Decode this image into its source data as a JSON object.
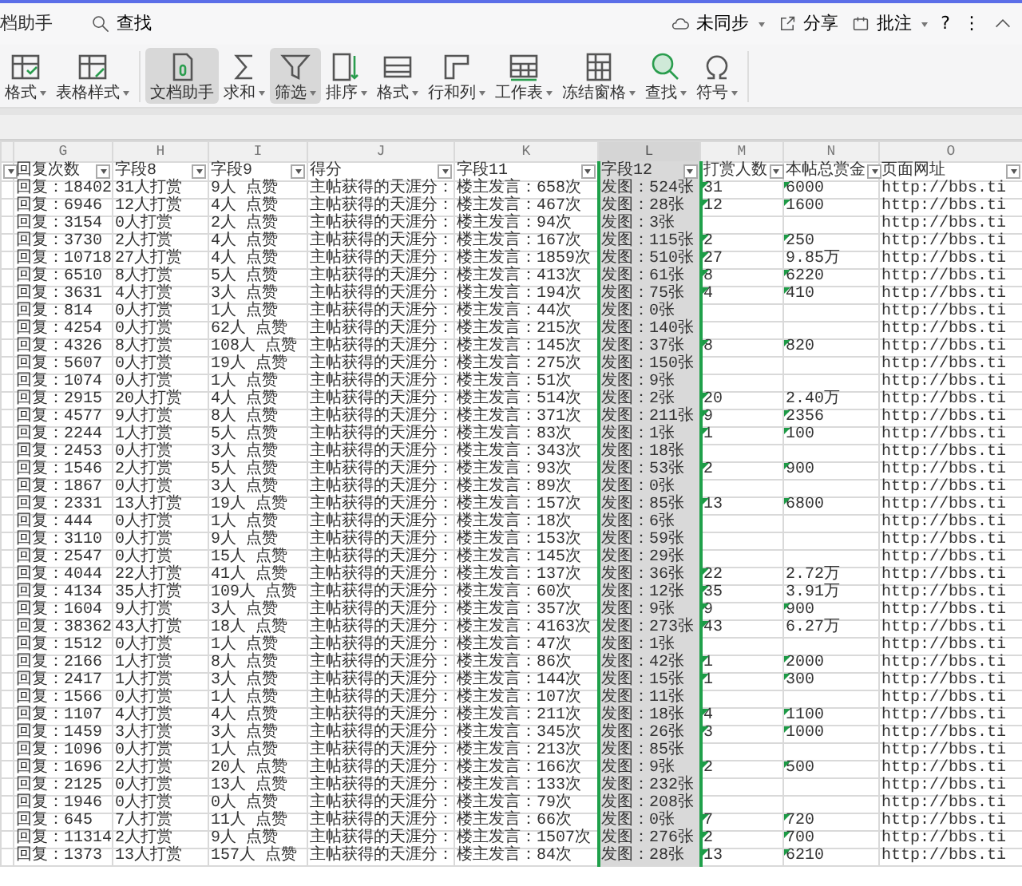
{
  "top_bar": {
    "tab": "档助手",
    "search": "查找",
    "sync": "未同步",
    "share": "分享",
    "comment": "批注",
    "help": "?",
    "more": "⋮"
  },
  "ribbon": [
    {
      "label": "格式",
      "kind": "table-format",
      "dropdown": true,
      "selected": false
    },
    {
      "label": "表格样式",
      "kind": "table-style",
      "dropdown": true,
      "selected": false
    },
    {
      "label": "文档助手",
      "kind": "assistant",
      "dropdown": false,
      "selected": true
    },
    {
      "label": "求和",
      "kind": "sum",
      "dropdown": true,
      "selected": false
    },
    {
      "label": "筛选",
      "kind": "filter",
      "dropdown": true,
      "selected": true
    },
    {
      "label": "排序",
      "kind": "sort",
      "dropdown": true,
      "selected": false
    },
    {
      "label": "格式",
      "kind": "cell-format",
      "dropdown": true,
      "selected": false
    },
    {
      "label": "行和列",
      "kind": "rows-cols",
      "dropdown": true,
      "selected": false
    },
    {
      "label": "工作表",
      "kind": "sheet",
      "dropdown": true,
      "selected": false
    },
    {
      "label": "冻结窗格",
      "kind": "freeze",
      "dropdown": true,
      "selected": false
    },
    {
      "label": "查找",
      "kind": "find",
      "dropdown": true,
      "selected": false
    },
    {
      "label": "符号",
      "kind": "symbol",
      "dropdown": true,
      "selected": false
    }
  ],
  "columns": [
    {
      "letter": "G",
      "heading": "回复次数",
      "selected": false
    },
    {
      "letter": "H",
      "heading": "字段8",
      "selected": false
    },
    {
      "letter": "I",
      "heading": "字段9",
      "selected": false
    },
    {
      "letter": "J",
      "heading": "得分",
      "selected": false
    },
    {
      "letter": "K",
      "heading": "字段11",
      "selected": false
    },
    {
      "letter": "L",
      "heading": "字段12",
      "selected": true
    },
    {
      "letter": "M",
      "heading": "打赏人数",
      "selected": false
    },
    {
      "letter": "N",
      "heading": "本帖总赏金",
      "selected": false
    },
    {
      "letter": "O",
      "heading": "页面网址",
      "selected": false
    }
  ],
  "rows": [
    {
      "cells": [
        "回复：18402",
        "31人打赏",
        "9人 点赞",
        "主帖获得的天涯分：",
        "楼主发言：658次",
        "发图：524张",
        "31",
        "6000",
        "http://bbs.ti"
      ],
      "m_flag": true,
      "n_flag": true
    },
    {
      "cells": [
        "回复：6946",
        "12人打赏",
        "4人 点赞",
        "主帖获得的天涯分：",
        "楼主发言：467次",
        "发图：28张",
        "12",
        "1600",
        "http://bbs.ti"
      ],
      "m_flag": true,
      "n_flag": true
    },
    {
      "cells": [
        "回复：3154",
        "0人打赏",
        "2人 点赞",
        "主帖获得的天涯分：",
        "楼主发言：94次",
        "发图：3张",
        null,
        null,
        "http://bbs.ti"
      ],
      "m_flag": false,
      "n_flag": false
    },
    {
      "cells": [
        "回复：3730",
        "2人打赏",
        "4人 点赞",
        "主帖获得的天涯分：",
        "楼主发言：167次",
        "发图：115张",
        "2",
        "250",
        "http://bbs.ti"
      ],
      "m_flag": true,
      "n_flag": true
    },
    {
      "cells": [
        "回复：10718",
        "27人打赏",
        "4人 点赞",
        "主帖获得的天涯分：",
        "楼主发言：1859次",
        "发图：510张",
        "27",
        "9.85万",
        "http://bbs.ti"
      ],
      "m_flag": true,
      "n_flag": false
    },
    {
      "cells": [
        "回复：6510",
        "8人打赏",
        "5人 点赞",
        "主帖获得的天涯分：",
        "楼主发言：413次",
        "发图：61张",
        "8",
        "6220",
        "http://bbs.ti"
      ],
      "m_flag": true,
      "n_flag": true
    },
    {
      "cells": [
        "回复：3631",
        "4人打赏",
        "3人 点赞",
        "主帖获得的天涯分：",
        "楼主发言：194次",
        "发图：75张",
        "4",
        "410",
        "http://bbs.ti"
      ],
      "m_flag": true,
      "n_flag": true
    },
    {
      "cells": [
        "回复：814",
        "0人打赏",
        "1人 点赞",
        "主帖获得的天涯分：",
        "楼主发言：44次",
        "发图：0张",
        null,
        null,
        "http://bbs.ti"
      ],
      "m_flag": false,
      "n_flag": false
    },
    {
      "cells": [
        "回复：4254",
        "0人打赏",
        "62人 点赞",
        "主帖获得的天涯分：",
        "楼主发言：215次",
        "发图：140张",
        null,
        null,
        "http://bbs.ti"
      ],
      "m_flag": false,
      "n_flag": false
    },
    {
      "cells": [
        "回复：4326",
        "8人打赏",
        "108人 点赞",
        "主帖获得的天涯分：",
        "楼主发言：145次",
        "发图：37张",
        "8",
        "820",
        "http://bbs.ti"
      ],
      "m_flag": true,
      "n_flag": true
    },
    {
      "cells": [
        "回复：5607",
        "0人打赏",
        "19人 点赞",
        "主帖获得的天涯分：",
        "楼主发言：275次",
        "发图：150张",
        null,
        null,
        "http://bbs.ti"
      ],
      "m_flag": false,
      "n_flag": false
    },
    {
      "cells": [
        "回复：1074",
        "0人打赏",
        "1人 点赞",
        "主帖获得的天涯分：",
        "楼主发言：51次",
        "发图：9张",
        null,
        null,
        "http://bbs.ti"
      ],
      "m_flag": false,
      "n_flag": false
    },
    {
      "cells": [
        "回复：2915",
        "20人打赏",
        "4人 点赞",
        "主帖获得的天涯分：",
        "楼主发言：514次",
        "发图：2张",
        "20",
        "2.40万",
        "http://bbs.ti"
      ],
      "m_flag": true,
      "n_flag": false
    },
    {
      "cells": [
        "回复：4577",
        "9人打赏",
        "8人 点赞",
        "主帖获得的天涯分：",
        "楼主发言：371次",
        "发图：211张",
        "9",
        "2356",
        "http://bbs.ti"
      ],
      "m_flag": true,
      "n_flag": true
    },
    {
      "cells": [
        "回复：2244",
        "1人打赏",
        "5人 点赞",
        "主帖获得的天涯分：",
        "楼主发言：83次",
        "发图：1张",
        "1",
        "100",
        "http://bbs.ti"
      ],
      "m_flag": true,
      "n_flag": true
    },
    {
      "cells": [
        "回复：2453",
        "0人打赏",
        "3人 点赞",
        "主帖获得的天涯分：",
        "楼主发言：343次",
        "发图：18张",
        null,
        null,
        "http://bbs.ti"
      ],
      "m_flag": false,
      "n_flag": false
    },
    {
      "cells": [
        "回复：1546",
        "2人打赏",
        "5人 点赞",
        "主帖获得的天涯分：",
        "楼主发言：93次",
        "发图：53张",
        "2",
        "900",
        "http://bbs.ti"
      ],
      "m_flag": true,
      "n_flag": true
    },
    {
      "cells": [
        "回复：1867",
        "0人打赏",
        "3人 点赞",
        "主帖获得的天涯分：",
        "楼主发言：89次",
        "发图：0张",
        null,
        null,
        "http://bbs.ti"
      ],
      "m_flag": false,
      "n_flag": false
    },
    {
      "cells": [
        "回复：2331",
        "13人打赏",
        "19人 点赞",
        "主帖获得的天涯分：",
        "楼主发言：157次",
        "发图：85张",
        "13",
        "6800",
        "http://bbs.ti"
      ],
      "m_flag": true,
      "n_flag": true
    },
    {
      "cells": [
        "回复：444",
        "0人打赏",
        "1人 点赞",
        "主帖获得的天涯分：",
        "楼主发言：18次",
        "发图：6张",
        null,
        null,
        "http://bbs.ti"
      ],
      "m_flag": false,
      "n_flag": false
    },
    {
      "cells": [
        "回复：3110",
        "0人打赏",
        "9人 点赞",
        "主帖获得的天涯分：",
        "楼主发言：153次",
        "发图：59张",
        null,
        null,
        "http://bbs.ti"
      ],
      "m_flag": false,
      "n_flag": false
    },
    {
      "cells": [
        "回复：2547",
        "0人打赏",
        "15人 点赞",
        "主帖获得的天涯分：",
        "楼主发言：145次",
        "发图：29张",
        null,
        null,
        "http://bbs.ti"
      ],
      "m_flag": false,
      "n_flag": false
    },
    {
      "cells": [
        "回复：4044",
        "22人打赏",
        "41人 点赞",
        "主帖获得的天涯分：",
        "楼主发言：137次",
        "发图：36张",
        "22",
        "2.72万",
        "http://bbs.ti"
      ],
      "m_flag": true,
      "n_flag": false
    },
    {
      "cells": [
        "回复：4134",
        "35人打赏",
        "109人 点赞",
        "主帖获得的天涯分：",
        "楼主发言：60次",
        "发图：12张",
        "35",
        "3.91万",
        "http://bbs.ti"
      ],
      "m_flag": true,
      "n_flag": false
    },
    {
      "cells": [
        "回复：1604",
        "9人打赏",
        "3人 点赞",
        "主帖获得的天涯分：",
        "楼主发言：357次",
        "发图：9张",
        "9",
        "900",
        "http://bbs.ti"
      ],
      "m_flag": true,
      "n_flag": true
    },
    {
      "cells": [
        "回复：38362",
        "43人打赏",
        "18人 点赞",
        "主帖获得的天涯分：",
        "楼主发言：4163次",
        "发图：273张",
        "43",
        "6.27万",
        "http://bbs.ti"
      ],
      "m_flag": true,
      "n_flag": false
    },
    {
      "cells": [
        "回复：1512",
        "0人打赏",
        "1人 点赞",
        "主帖获得的天涯分：",
        "楼主发言：47次",
        "发图：1张",
        null,
        null,
        "http://bbs.ti"
      ],
      "m_flag": false,
      "n_flag": false
    },
    {
      "cells": [
        "回复：2166",
        "1人打赏",
        "8人 点赞",
        "主帖获得的天涯分：",
        "楼主发言：86次",
        "发图：42张",
        "1",
        "2000",
        "http://bbs.ti"
      ],
      "m_flag": true,
      "n_flag": true
    },
    {
      "cells": [
        "回复：2417",
        "1人打赏",
        "3人 点赞",
        "主帖获得的天涯分：",
        "楼主发言：144次",
        "发图：15张",
        "1",
        "300",
        "http://bbs.ti"
      ],
      "m_flag": true,
      "n_flag": true
    },
    {
      "cells": [
        "回复：1566",
        "0人打赏",
        "1人 点赞",
        "主帖获得的天涯分：",
        "楼主发言：107次",
        "发图：11张",
        null,
        null,
        "http://bbs.ti"
      ],
      "m_flag": false,
      "n_flag": false
    },
    {
      "cells": [
        "回复：1107",
        "4人打赏",
        "4人 点赞",
        "主帖获得的天涯分：",
        "楼主发言：211次",
        "发图：18张",
        "4",
        "1100",
        "http://bbs.ti"
      ],
      "m_flag": true,
      "n_flag": true
    },
    {
      "cells": [
        "回复：1459",
        "3人打赏",
        "3人 点赞",
        "主帖获得的天涯分：",
        "楼主发言：345次",
        "发图：26张",
        "3",
        "1000",
        "http://bbs.ti"
      ],
      "m_flag": true,
      "n_flag": true
    },
    {
      "cells": [
        "回复：1096",
        "0人打赏",
        "1人 点赞",
        "主帖获得的天涯分：",
        "楼主发言：213次",
        "发图：85张",
        null,
        null,
        "http://bbs.ti"
      ],
      "m_flag": false,
      "n_flag": false
    },
    {
      "cells": [
        "回复：1696",
        "2人打赏",
        "20人 点赞",
        "主帖获得的天涯分：",
        "楼主发言：166次",
        "发图：9张",
        "2",
        "500",
        "http://bbs.ti"
      ],
      "m_flag": true,
      "n_flag": true
    },
    {
      "cells": [
        "回复：2125",
        "0人打赏",
        "13人 点赞",
        "主帖获得的天涯分：",
        "楼主发言：133次",
        "发图：232张",
        null,
        null,
        "http://bbs.ti"
      ],
      "m_flag": false,
      "n_flag": false
    },
    {
      "cells": [
        "回复：1946",
        "0人打赏",
        "0人 点赞",
        "主帖获得的天涯分：",
        "楼主发言：79次",
        "发图：208张",
        null,
        null,
        "http://bbs.ti"
      ],
      "m_flag": false,
      "n_flag": false
    },
    {
      "cells": [
        "回复：645",
        "7人打赏",
        "11人 点赞",
        "主帖获得的天涯分：",
        "楼主发言：66次",
        "发图：0张",
        "7",
        "720",
        "http://bbs.ti"
      ],
      "m_flag": true,
      "n_flag": true
    },
    {
      "cells": [
        "回复：11314",
        "2人打赏",
        "9人 点赞",
        "主帖获得的天涯分：",
        "楼主发言：1507次",
        "发图：276张",
        "2",
        "700",
        "http://bbs.ti"
      ],
      "m_flag": true,
      "n_flag": true
    },
    {
      "cells": [
        "回复：1373",
        "13人打赏",
        "157人 点赞",
        "主帖获得的天涯分：",
        "楼主发言：84次",
        "发图：28张",
        "13",
        "6210",
        "http://bbs.ti"
      ],
      "m_flag": true,
      "n_flag": true
    }
  ]
}
